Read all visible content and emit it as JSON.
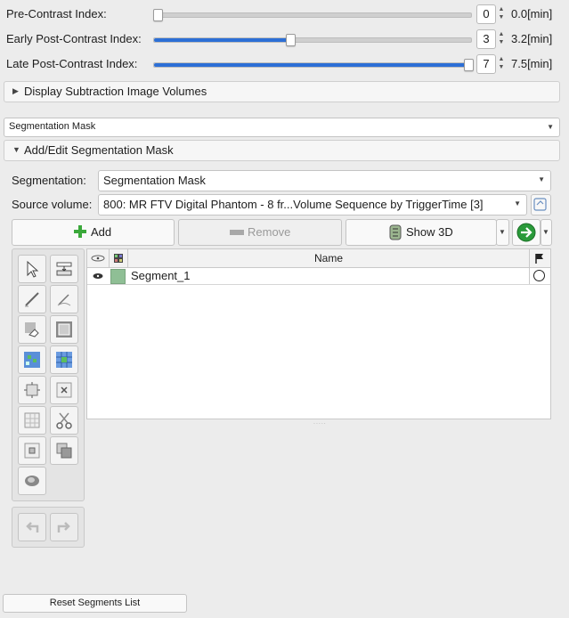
{
  "sliders": [
    {
      "label": "Pre-Contrast Index:",
      "value": "0",
      "display": "0.0[min]",
      "fraction": 0.0
    },
    {
      "label": "Early Post-Contrast Index:",
      "value": "3",
      "display": "3.2[min]",
      "fraction": 0.43
    },
    {
      "label": "Late Post-Contrast Index:",
      "value": "7",
      "display": "7.5[min]",
      "fraction": 1.0
    }
  ],
  "subtraction_header": "Display Subtraction Image Volumes",
  "top_combo": "Segmentation Mask",
  "edit_header": "Add/Edit Segmentation Mask",
  "segmentation_label": "Segmentation:",
  "segmentation_value": "Segmentation Mask",
  "source_label": "Source volume:",
  "source_value": "800: MR FTV Digital Phantom - 8 fr...Volume Sequence by TriggerTime [3]",
  "buttons": {
    "add": "Add",
    "remove": "Remove",
    "show3d": "Show 3D"
  },
  "table": {
    "name_header": "Name",
    "rows": [
      {
        "name": "Segment_1",
        "color": "#8fbf95"
      }
    ]
  },
  "reset_label": "Reset Segments List",
  "colors": {
    "accent": "#2c6fd6",
    "segment": "#8fbf95",
    "go": "#2a9a3a"
  }
}
